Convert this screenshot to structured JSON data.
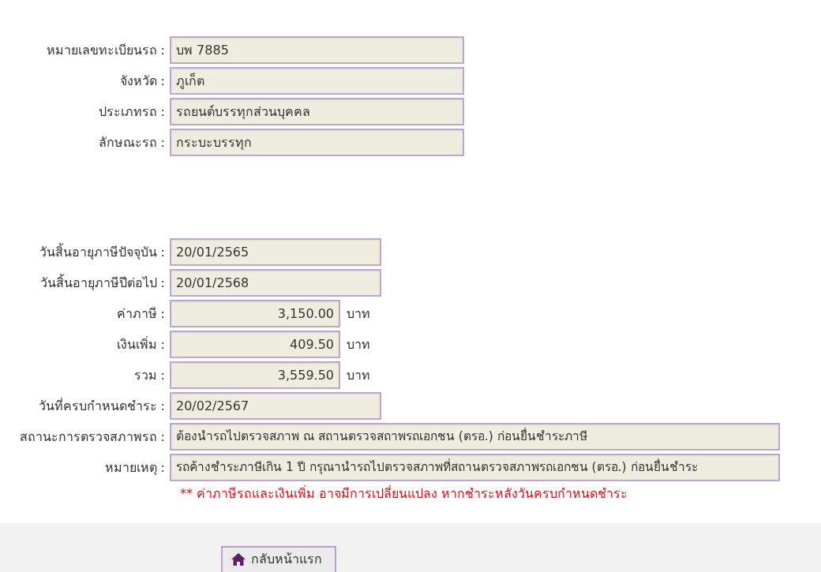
{
  "vehicle": [
    {
      "label": "หมายเลขทะเบียนรถ :",
      "value": "บพ 7885",
      "kind": "text"
    },
    {
      "label": "จังหวัด :",
      "value": "ภูเก็ต",
      "kind": "text"
    },
    {
      "label": "ประเภทรถ :",
      "value": "รถยนต์บรรทุกส่วนบุคคล",
      "kind": "text"
    },
    {
      "label": "ลักษณะรถ :",
      "value": "กระบะบรรทุก",
      "kind": "text"
    }
  ],
  "tax": [
    {
      "label": "วันสิ้นอายุภาษีปัจจุบัน :",
      "value": "20/01/2565",
      "kind": "date"
    },
    {
      "label": "วันสิ้นอายุภาษีปีต่อไป :",
      "value": "20/01/2568",
      "kind": "date"
    },
    {
      "label": "ค่าภาษี :",
      "value": "3,150.00",
      "kind": "amount",
      "unit": "บาท"
    },
    {
      "label": "เงินเพิ่ม :",
      "value": "409.50",
      "kind": "amount",
      "unit": "บาท"
    },
    {
      "label": "รวม :",
      "value": "3,559.50",
      "kind": "amount",
      "unit": "บาท"
    },
    {
      "label": "วันที่ครบกำหนดชำระ :",
      "value": "20/02/2567",
      "kind": "date"
    },
    {
      "label": "สถานะการตรวจสภาพรถ :",
      "value": "ต้องนำรถไปตรวจสภาพ ณ สถานตรวจสถาพรถเอกชน (ตรอ.) ก่อนยื่นชำระภาษี",
      "kind": "long"
    },
    {
      "label": "หมายเหตุ :",
      "value": "รถค้างชำระภาษีเกิน 1 ปี กรุณานำรถไปตรวจสภาพที่สถานตรวจสภาพรถเอกชน (ตรอ.) ก่อนยื่นชำระ",
      "kind": "long"
    }
  ],
  "warning": "** ค่าภาษีรถและเงินเพิ่ม อาจมีการเปลี่ยนแปลง หากชำระหลังวันครบกำหนดชำระ",
  "home_button": "กลับหน้าแรก"
}
